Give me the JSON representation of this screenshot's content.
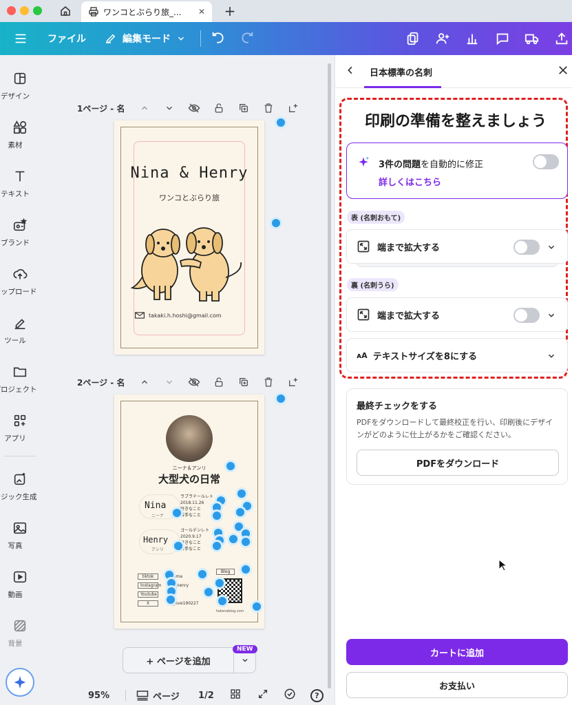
{
  "window": {
    "tab_title": "ワンコとぶらり旅_...",
    "close_glyph": "✕",
    "new_tab_glyph": "+"
  },
  "toolbar": {
    "file_label": "ファイル",
    "mode_label": "編集モード"
  },
  "sidebar": {
    "items": [
      {
        "label": "デザイン",
        "icon": "design-icon"
      },
      {
        "label": "素材",
        "icon": "elements-icon"
      },
      {
        "label": "テキスト",
        "icon": "text-icon"
      },
      {
        "label": "ブランド",
        "icon": "brand-icon"
      },
      {
        "label": "アップロード",
        "icon": "upload-icon"
      },
      {
        "label": "ツール",
        "icon": "tools-icon"
      },
      {
        "label": "プロジェクト",
        "icon": "folder-icon"
      },
      {
        "label": "アプリ",
        "icon": "apps-icon"
      },
      {
        "label": "マジック生成",
        "icon": "magic-icon"
      },
      {
        "label": "写真",
        "icon": "photo-icon"
      },
      {
        "label": "動画",
        "icon": "video-icon"
      },
      {
        "label": "背景",
        "icon": "background-icon"
      }
    ]
  },
  "canvas": {
    "page1_label": "1ページ - 名",
    "page2_label": "2ページ - 名",
    "card1": {
      "title": "Nina & Henry",
      "subtitle": "ワンコとぶらり旅",
      "email": "takaki.h.hoshi@gmail.com"
    },
    "card2": {
      "small_title": "ニーナ＆アンリ",
      "title": "大型犬の日常",
      "nina_name": "Nina",
      "nina_kana": "ニーナ",
      "nina_lines": [
        "ラブラドールレト",
        "2018.11.26",
        "好きなこと",
        "苦手なこと"
      ],
      "henry_name": "Henry",
      "henry_kana": "アンリ",
      "henry_lines": [
        "ゴールデンレト",
        "2020.9.17",
        "好きなこと",
        "苦手なこと"
      ],
      "sns": [
        "tiktok",
        "Instagram",
        "Youtube",
        "X"
      ],
      "sns_values": [
        "nima",
        "a_henry",
        "",
        "_love190227"
      ],
      "blog": "Blog",
      "qr_caption": "hatenablog.com"
    },
    "add_page_label": "+ ページを追加",
    "new_badge": "NEW"
  },
  "footer": {
    "zoom": "95%",
    "pages_label": "ページ",
    "page_count": "1/2",
    "help": "?"
  },
  "panel": {
    "header_title": "日本標準の名刺",
    "heading": "印刷の準備を整えましょう",
    "issues_bold": "3件の問題",
    "issues_rest": "を自動的に修正",
    "details_link": "詳しくはこちら",
    "front_label": "表 (名刺おもて)",
    "front_extend": "端まで拡大する",
    "back_label": "裏 (名刺うら)",
    "back_extend": "端まで拡大する",
    "text_size": "テキストサイズを8にする",
    "final_title": "最終チェックをする",
    "final_desc": "PDFをダウンロードして最終校正を行い、印刷後にデザインがどのように仕上がるかをご確認ください。",
    "pdf_button": "PDFをダウンロード",
    "cart_button": "カートに追加",
    "pay_button": "お支払い"
  },
  "colors": {
    "accent": "#7d2ae8",
    "highlight_red": "#e02020"
  }
}
